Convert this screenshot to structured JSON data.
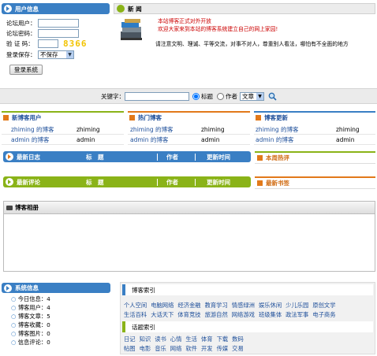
{
  "login": {
    "title": "用户信息",
    "username_label": "论坛用户：",
    "password_label": "论坛密码：",
    "code_label": "验 证 码：",
    "captcha": "8366",
    "save_label": "登录保存：",
    "save_option": "不保存",
    "login_button": "登录系统"
  },
  "news": {
    "title": "新 闻",
    "line1": "本站博客正式对外开放",
    "line2": "欢迎大家来到本站的博客系统建立自己的网上家园!",
    "line3": "请注意文明、理诚、平等交流，对事不对人，尊重别人看法，哪怕有不全面的地方"
  },
  "search": {
    "keyword_label": "关键字：",
    "radio_title": "标题",
    "radio_author": "作者",
    "select_value": "文章"
  },
  "new_users": {
    "title": "新博客用户",
    "rows": [
      {
        "blog": "zhiming 的博客",
        "user": "zhiming"
      },
      {
        "blog": "admin 的博客",
        "user": "admin"
      }
    ]
  },
  "hot_blogs": {
    "title": "热门博客",
    "rows": [
      {
        "blog": "zhiming 的博客",
        "user": "zhiming"
      },
      {
        "blog": "admin 的博客",
        "user": "admin"
      }
    ]
  },
  "updated_blogs": {
    "title": "博客更新",
    "rows": [
      {
        "blog": "zhiming 的博客",
        "user": "zhiming"
      },
      {
        "blog": "admin 的博客",
        "user": "admin"
      }
    ]
  },
  "latest_posts": {
    "title": "最新日志",
    "col_title": "标　题",
    "col_author": "作者",
    "col_time": "更新时间"
  },
  "latest_comments": {
    "title": "最新评论",
    "col_title": "标　题",
    "col_author": "作者",
    "col_time": "更新时间"
  },
  "weekly_hot": {
    "title": "本周热评"
  },
  "latest_bookmarks": {
    "title": "最新书签"
  },
  "album": {
    "title": "博客相册"
  },
  "system": {
    "title": "系统信息",
    "items": [
      "今日信息：4",
      "博客用户：4",
      "博客文章：5",
      "博客收藏：0",
      "博客图片：0",
      "信息评论：0"
    ]
  },
  "blog_index": {
    "title": "博客索引",
    "row1": [
      "个人空间",
      "电脑网络",
      "经济金融",
      "教育学习",
      "情感绿洲",
      "娱乐休闲",
      "少儿乐园",
      "原创文学"
    ],
    "row2": [
      "生活百科",
      "大话天下",
      "体育竞技",
      "旅游自然",
      "网络游戏",
      "班级集体",
      "政法军事",
      "电子商务"
    ]
  },
  "topic_index": {
    "title": "话题索引",
    "row1": [
      "日记",
      "知识",
      "读书",
      "心情",
      "生活",
      "体育",
      "下载",
      "数码"
    ],
    "row2": [
      "帖图",
      "电影",
      "音乐",
      "网络",
      "软件",
      "开发",
      "传媒",
      "交易"
    ]
  },
  "colors": {
    "blue_bar": "#3a7fc4",
    "green_bar": "#8ab318",
    "orange_bar": "#e2791a",
    "link": "#1e4f9a",
    "news_red": "#cc0000"
  }
}
